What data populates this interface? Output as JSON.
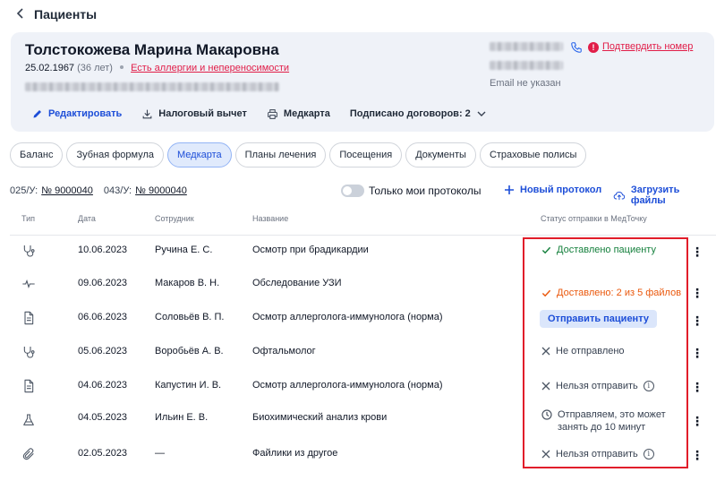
{
  "header": {
    "back_icon": "chevron-left-icon",
    "title": "Пациенты"
  },
  "patient": {
    "name": "Толстокожева Марина Макаровна",
    "dob": "25.02.1967",
    "age": "(36 лет)",
    "allergy_link": "Есть аллергии и непереносимости",
    "confirm_phone": "Подтвердить номер",
    "email": "Email не указан"
  },
  "actions": {
    "edit": "Редактировать",
    "tax": "Налоговый вычет",
    "medcard": "Медкарта",
    "contracts": "Подписано договоров: 2"
  },
  "tabs": [
    "Баланс",
    "Зубная формула",
    "Медкарта",
    "Планы лечения",
    "Посещения",
    "Документы",
    "Страховые полисы"
  ],
  "active_tab": "Медкарта",
  "ids": {
    "f025_label": "025/У:",
    "f025_value": "№ 9000040",
    "f043_label": "043/У:",
    "f043_value": "№ 9000040"
  },
  "toolbar": {
    "toggle_label": "Только мои протоколы",
    "toggle_on": false,
    "new_protocol": "Новый протокол",
    "upload": "Загрузить файлы"
  },
  "table": {
    "columns": {
      "type": "Тип",
      "date": "Дата",
      "employee": "Сотрудник",
      "name": "Название",
      "status": "Статус отправки в МедТочку"
    },
    "rows": [
      {
        "icon": "stethoscope-icon",
        "date": "10.06.2023",
        "employee": "Ручина Е. С.",
        "name": "Осмотр при брадикардии",
        "status": "Доставлено пациенту"
      },
      {
        "icon": "pulse-icon",
        "date": "09.06.2023",
        "employee": "Макаров В. Н.",
        "name": "Обследование УЗИ",
        "status": "Доставлено: 2 из 5 файлов"
      },
      {
        "icon": "document-icon",
        "date": "06.06.2023",
        "employee": "Соловьёв В. П.",
        "name": "Осмотр аллерголога-иммунолога (норма)",
        "status": "Отправить пациенту"
      },
      {
        "icon": "stethoscope-icon",
        "date": "05.06.2023",
        "employee": "Воробьёв А. В.",
        "name": "Офтальмолог",
        "status": "Не отправлено"
      },
      {
        "icon": "document-icon",
        "date": "04.06.2023",
        "employee": "Капустин И. В.",
        "name": "Осмотр аллерголога-иммунолога (норма)",
        "status": "Нельзя отправить"
      },
      {
        "icon": "flask-icon",
        "date": "04.05.2023",
        "employee": "Ильин Е. В.",
        "name": "Биохимический анализ крови",
        "status_line1": "Отправляем, это может",
        "status_line2": "занять до 10 минут"
      },
      {
        "icon": "paperclip-icon",
        "date": "02.05.2023",
        "employee": "—",
        "name": "Файлики из другое",
        "status": "Нельзя отправить"
      }
    ]
  },
  "colors": {
    "accent": "#1d4ed8",
    "danger": "#e11d48",
    "success": "#15803d",
    "warning": "#ea580c",
    "highlight": "#e11d2a"
  }
}
